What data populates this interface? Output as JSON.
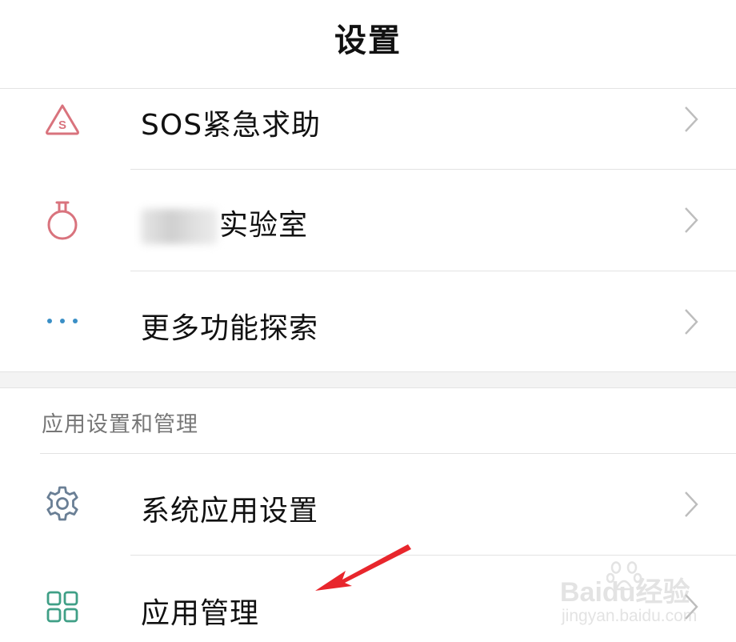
{
  "header": {
    "title": "设置"
  },
  "rows_top": [
    {
      "label": "SOS紧急求助",
      "icon": "sos-icon"
    },
    {
      "label": "实验室",
      "icon": "flask-icon",
      "label_prefix_blurred": true
    },
    {
      "label": "更多功能探索",
      "icon": "more-dots-icon"
    }
  ],
  "section": {
    "header": "应用设置和管理"
  },
  "rows_bottom": [
    {
      "label": "系统应用设置",
      "icon": "gear-icon"
    },
    {
      "label": "应用管理",
      "icon": "grid-apps-icon"
    }
  ],
  "watermark": {
    "brand": "Baidu经验",
    "url": "jingyan.baidu.com"
  },
  "colors": {
    "icon_pink": "#d9737d",
    "icon_blue": "#3a8fc6",
    "icon_slate": "#6a7f95",
    "icon_green": "#3f9f86",
    "annotation_arrow": "#e8262c",
    "divider": "#e3e3e3",
    "section_band": "#f3f3f3"
  }
}
